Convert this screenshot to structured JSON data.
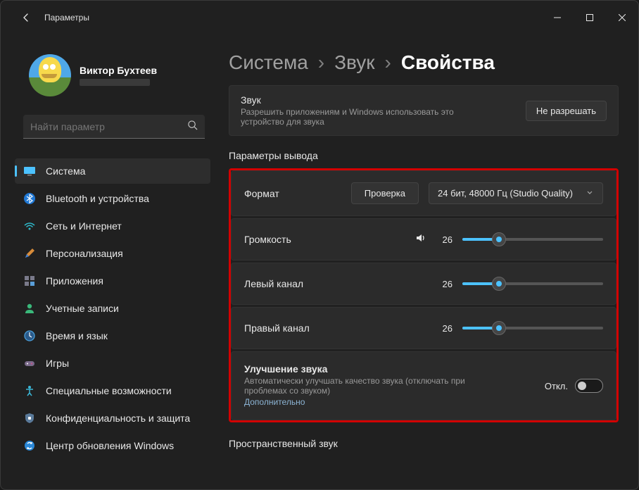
{
  "titlebar": {
    "title": "Параметры"
  },
  "profile": {
    "name": "Виктор Бухтеев"
  },
  "search": {
    "placeholder": "Найти параметр"
  },
  "sidebar": {
    "items": [
      {
        "label": "Система"
      },
      {
        "label": "Bluetooth и устройства"
      },
      {
        "label": "Сеть и Интернет"
      },
      {
        "label": "Персонализация"
      },
      {
        "label": "Приложения"
      },
      {
        "label": "Учетные записи"
      },
      {
        "label": "Время и язык"
      },
      {
        "label": "Игры"
      },
      {
        "label": "Специальные возможности"
      },
      {
        "label": "Конфиденциальность и защита"
      },
      {
        "label": "Центр обновления Windows"
      }
    ]
  },
  "breadcrumb": {
    "root": "Система",
    "parent": "Звук",
    "current": "Свойства",
    "sep": "›"
  },
  "permission": {
    "title": "Звук",
    "sub": "Разрешить приложениям и Windows использовать это устройство для звука",
    "button": "Не разрешать"
  },
  "output_section": {
    "title": "Параметры вывода"
  },
  "format": {
    "label": "Формат",
    "test": "Проверка",
    "selected": "24 бит, 48000 Гц (Studio Quality)"
  },
  "volume": {
    "label": "Громкость",
    "value": "26",
    "percent": 26
  },
  "left": {
    "label": "Левый канал",
    "value": "26",
    "percent": 26
  },
  "right": {
    "label": "Правый канал",
    "value": "26",
    "percent": 26
  },
  "enhance": {
    "title": "Улучшение звука",
    "sub": "Автоматически улучшать качество звука (отключать при проблемах со звуком)",
    "link": "Дополнительно",
    "state": "Откл."
  },
  "next_section": {
    "title": "Пространственный звук"
  }
}
